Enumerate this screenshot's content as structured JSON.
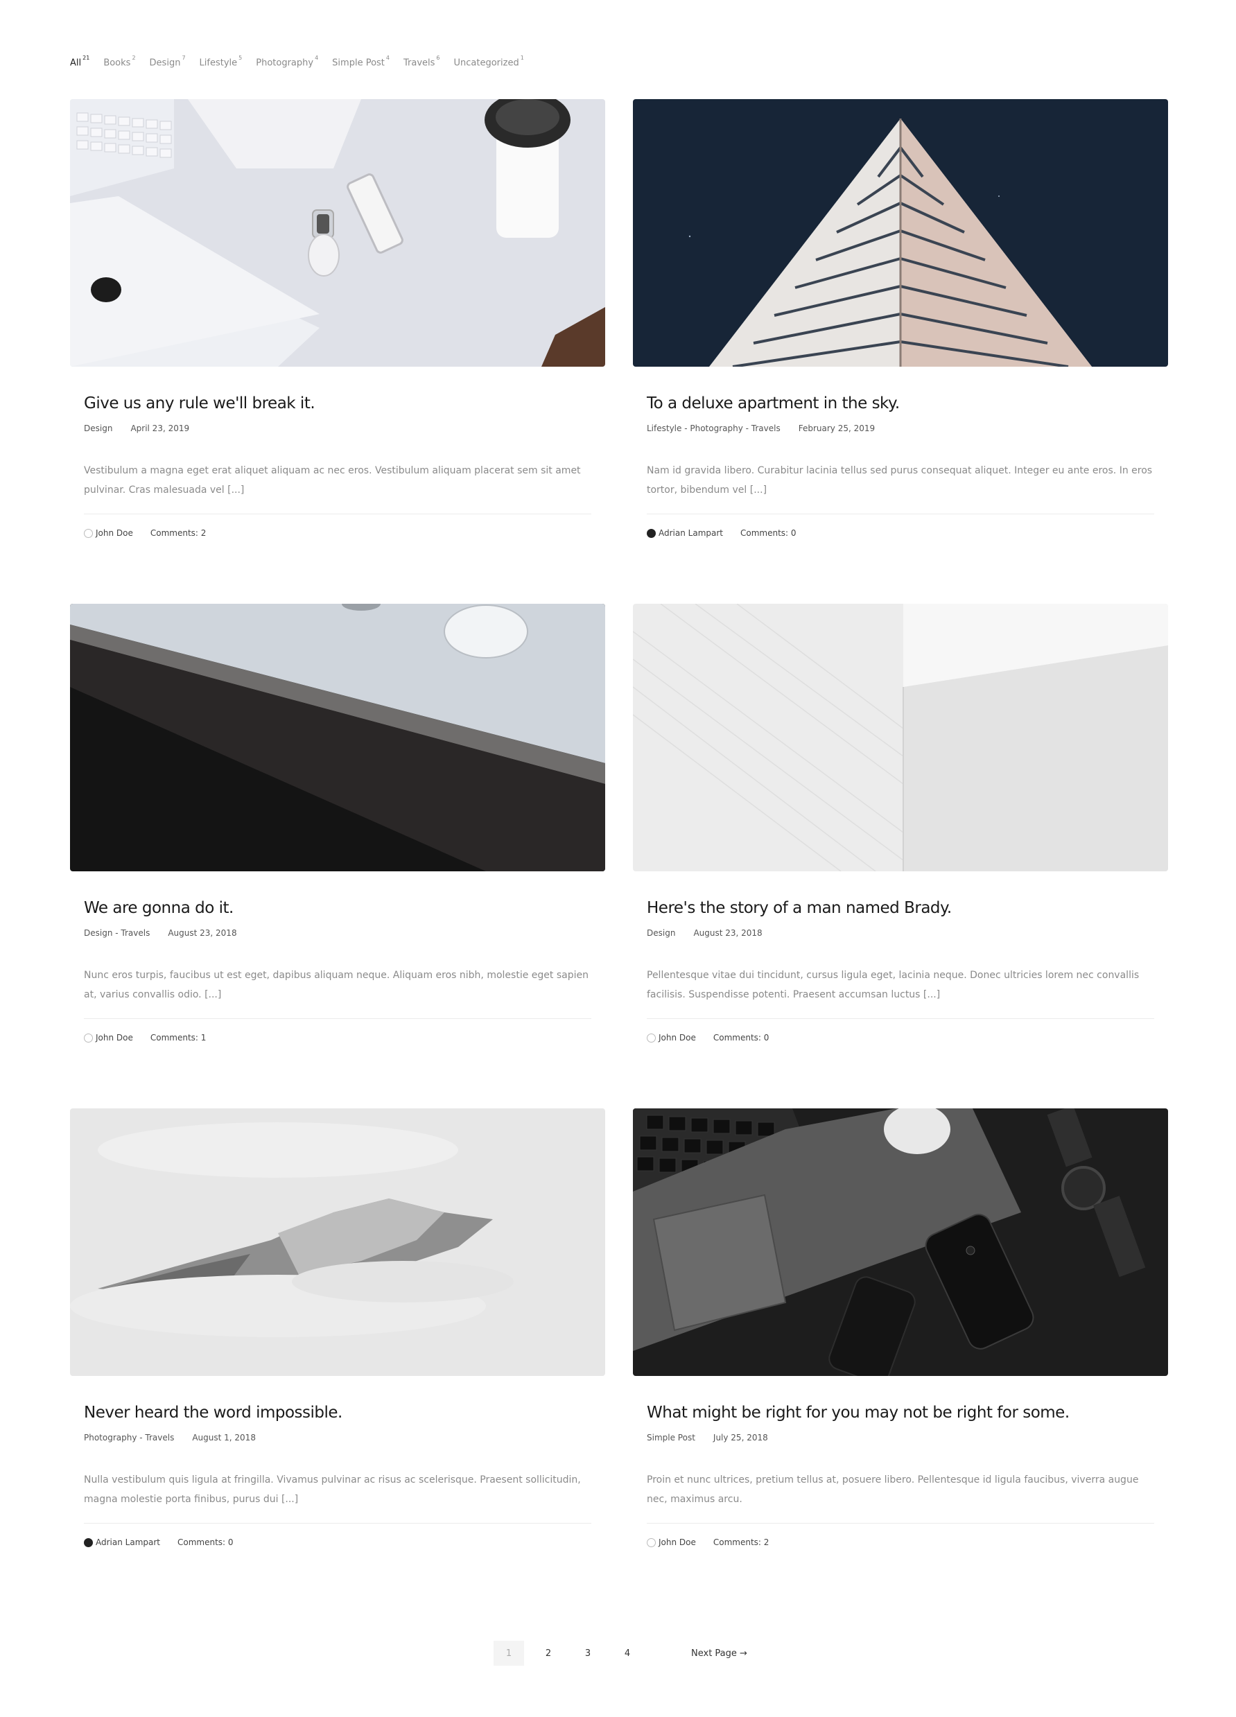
{
  "filters": [
    {
      "label": "All",
      "count": "21"
    },
    {
      "label": "Books",
      "count": "2"
    },
    {
      "label": "Design",
      "count": "7"
    },
    {
      "label": "Lifestyle",
      "count": "5"
    },
    {
      "label": "Photography",
      "count": "4"
    },
    {
      "label": "Simple Post",
      "count": "4"
    },
    {
      "label": "Travels",
      "count": "6"
    },
    {
      "label": "Uncategorized",
      "count": "1"
    }
  ],
  "posts": [
    {
      "title": "Give us any rule we'll break it.",
      "categories": "Design",
      "date": "April 23, 2019",
      "excerpt": "Vestibulum a magna eget erat aliquet aliquam ac nec eros. Vestibulum aliquam placerat sem sit amet pulvinar. Cras malesuada vel [...]",
      "author": "John Doe",
      "comments": "Comments: 2"
    },
    {
      "title": "To a deluxe apartment in the sky.",
      "categories": "Lifestyle - Photography - Travels",
      "date": "February 25, 2019",
      "excerpt": "Nam id gravida libero. Curabitur lacinia tellus sed purus consequat aliquet. Integer eu ante eros. In eros tortor, bibendum vel [...]",
      "author": "Adrian Lampart",
      "comments": "Comments: 0"
    },
    {
      "title": "We are gonna do it.",
      "categories": "Design - Travels",
      "date": "August 23, 2018",
      "excerpt": "Nunc eros turpis, faucibus ut est eget, dapibus aliquam neque. Aliquam eros nibh, molestie eget sapien at, varius convallis odio. [...]",
      "author": "John Doe",
      "comments": "Comments: 1"
    },
    {
      "title": "Here's the story of a man named Brady.",
      "categories": "Design",
      "date": "August 23, 2018",
      "excerpt": "Pellentesque vitae dui tincidunt, cursus ligula eget, lacinia neque. Donec ultricies lorem nec convallis facilisis. Suspendisse potenti. Praesent accumsan luctus [...]",
      "author": "John Doe",
      "comments": "Comments: 0"
    },
    {
      "title": "Never heard the word impossible.",
      "categories": "Photography - Travels",
      "date": "August 1, 2018",
      "excerpt": "Nulla vestibulum quis ligula at fringilla. Vivamus pulvinar ac risus ac scelerisque. Praesent sollicitudin, magna molestie porta finibus, purus dui [...]",
      "author": "Adrian Lampart",
      "comments": "Comments: 0"
    },
    {
      "title": "What might be right for you may not be right for some.",
      "categories": "Simple Post",
      "date": "July 25, 2018",
      "excerpt": "Proin et nunc ultrices, pretium tellus at, posuere libero. Pellentesque id ligula faucibus, viverra augue nec, maximus arcu.",
      "author": "John Doe",
      "comments": "Comments: 2"
    }
  ],
  "pagination": {
    "pages": [
      "1",
      "2",
      "3",
      "4"
    ],
    "current": "1",
    "next_label": "Next Page →"
  }
}
